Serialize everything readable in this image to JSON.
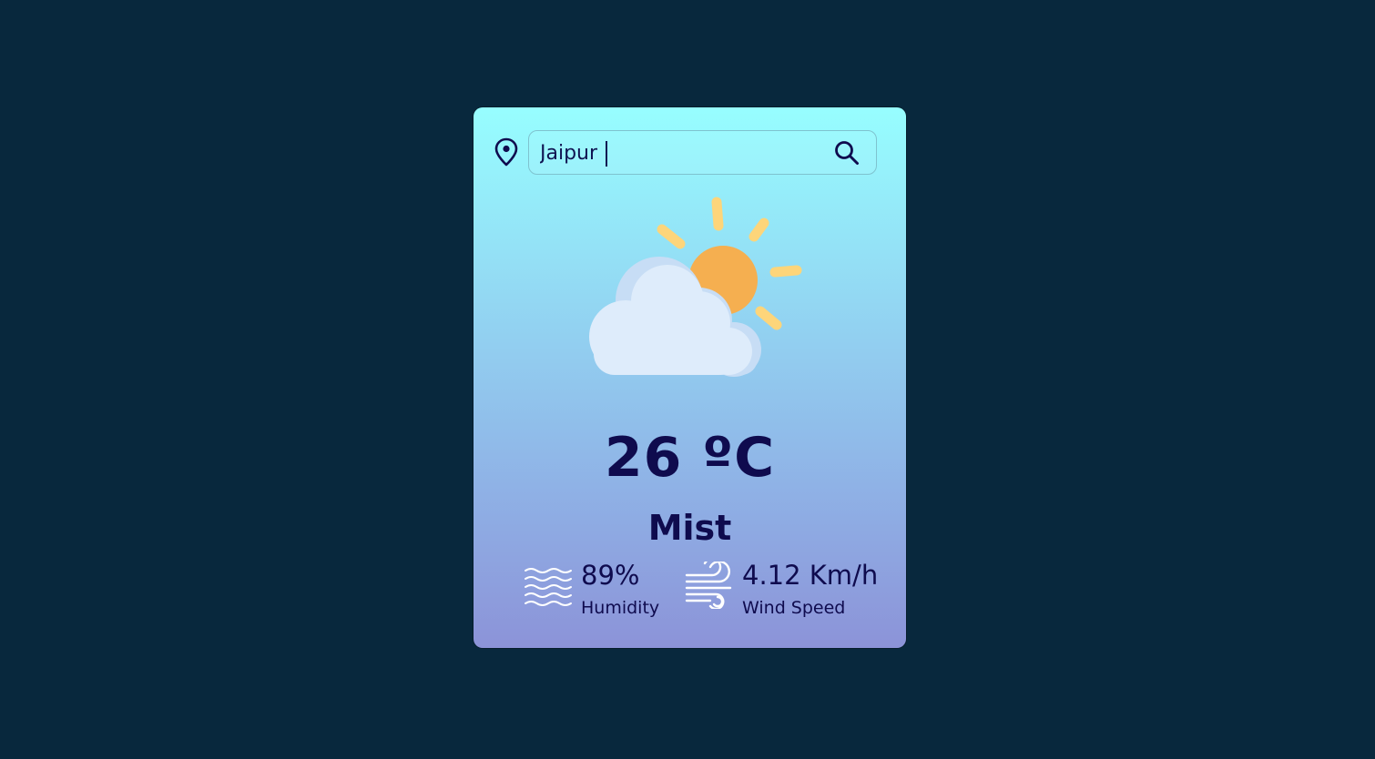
{
  "search": {
    "value": "Jaipur",
    "placeholder": ""
  },
  "icons": {
    "location": "location-pin-icon",
    "search": "search-icon",
    "weather": "partly-cloudy-icon",
    "humidity": "humidity-waves-icon",
    "wind": "wind-icon"
  },
  "weather": {
    "temperature": "26 ºC",
    "condition": "Mist"
  },
  "humidity": {
    "value": "89%",
    "label": "Humidity"
  },
  "wind": {
    "value": "4.12 Km/h",
    "label": "Wind Speed"
  },
  "colors": {
    "background": "#08283d",
    "card_top": "#97feff",
    "card_bottom": "#8c93d8",
    "text": "#0f0b4e",
    "sun": "#f5af50",
    "sun_rays": "#fdd57a",
    "cloud": "#deecfb"
  }
}
